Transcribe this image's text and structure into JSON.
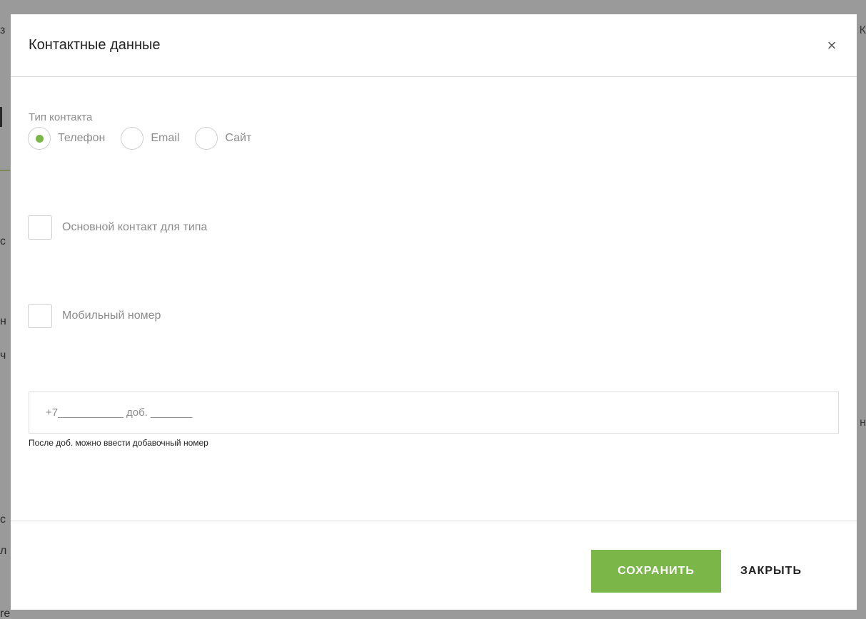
{
  "background": {
    "fragments": {
      "f1": "з",
      "f2": "К",
      "f3": "с",
      "f4": "н",
      "f5": "ч",
      "f6": "н",
      "f7": "с",
      "f8": "л",
      "f9": "re"
    }
  },
  "modal": {
    "title": "Контактные данные",
    "close_glyph": "×",
    "contact_type_label": "Тип контакта",
    "radios": {
      "phone": "Телефон",
      "email": "Email",
      "site": "Сайт"
    },
    "selected_radio": "Телефон",
    "main_contact_label": "Основной контакт для типа",
    "mobile_label": "Мобильный номер",
    "phone_placeholder": "+7___________ доб. _______",
    "hint": "После доб. можно ввести добавочный номер",
    "save_label": "СОХРАНИТЬ",
    "close_label": "ЗАКРЫТЬ"
  },
  "colors": {
    "accent": "#7ab648",
    "overlay": "#9a9a9a"
  }
}
